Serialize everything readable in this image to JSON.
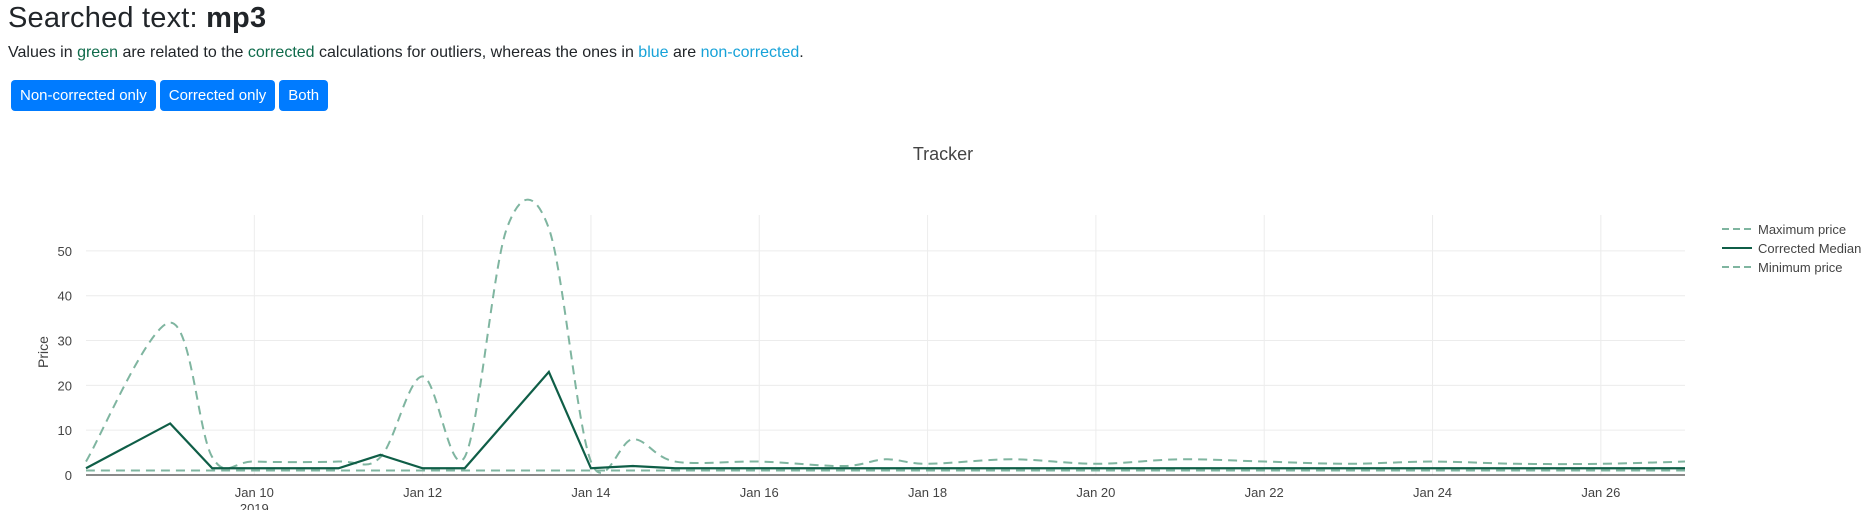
{
  "header": {
    "title_prefix": "Searched text: ",
    "title_term": "mp3"
  },
  "description": {
    "part1": "Values in ",
    "green_word": "green",
    "part2": " are related to the ",
    "corrected_word": "corrected",
    "part3": " calculations for outliers, whereas the ones in ",
    "blue_word": "blue",
    "part4": " are ",
    "noncorrected_word": "non-corrected",
    "part5": "."
  },
  "buttons": {
    "non_corrected": "Non-corrected only",
    "corrected": "Corrected only",
    "both": "Both"
  },
  "colors": {
    "button": "#007bff",
    "corrected": "#0f6b4b",
    "non_corrected": "#17a2d8",
    "series_dashed": "#7fb5a0",
    "series_solid": "#0f5e47"
  },
  "chart_data": {
    "type": "line",
    "title": "Tracker",
    "ylabel": "Price",
    "xlabel": "",
    "ylim": [
      0,
      58
    ],
    "y_ticks": [
      0,
      10,
      20,
      30,
      40,
      50
    ],
    "x_range": [
      "2019-01-08",
      "2019-01-27"
    ],
    "x_ticks": [
      {
        "date": "2019-01-10",
        "label": "Jan 10",
        "sublabel": "2019"
      },
      {
        "date": "2019-01-12",
        "label": "Jan 12",
        "sublabel": ""
      },
      {
        "date": "2019-01-14",
        "label": "Jan 14",
        "sublabel": ""
      },
      {
        "date": "2019-01-16",
        "label": "Jan 16",
        "sublabel": ""
      },
      {
        "date": "2019-01-18",
        "label": "Jan 18",
        "sublabel": ""
      },
      {
        "date": "2019-01-20",
        "label": "Jan 20",
        "sublabel": ""
      },
      {
        "date": "2019-01-22",
        "label": "Jan 22",
        "sublabel": ""
      },
      {
        "date": "2019-01-24",
        "label": "Jan 24",
        "sublabel": ""
      },
      {
        "date": "2019-01-26",
        "label": "Jan 26",
        "sublabel": ""
      }
    ],
    "grid": true,
    "legend_position": "top-right",
    "series": [
      {
        "name": "Maximum price",
        "dash": "dashed",
        "x": [
          "2019-01-08",
          "2019-01-09",
          "2019-01-09 12:00",
          "2019-01-10",
          "2019-01-11",
          "2019-01-11 12:00",
          "2019-01-12",
          "2019-01-12 12:00",
          "2019-01-13",
          "2019-01-13 12:00",
          "2019-01-14",
          "2019-01-14 12:00",
          "2019-01-15",
          "2019-01-16",
          "2019-01-17",
          "2019-01-17 12:00",
          "2019-01-18",
          "2019-01-19",
          "2019-01-20",
          "2019-01-21",
          "2019-01-22",
          "2019-01-23",
          "2019-01-24",
          "2019-01-25",
          "2019-01-26",
          "2019-01-27"
        ],
        "y": [
          3,
          34,
          4,
          3,
          3,
          4,
          22,
          4,
          55,
          55,
          3,
          8,
          3,
          3,
          2,
          3.5,
          2.5,
          3.5,
          2.5,
          3.5,
          3,
          2.5,
          3,
          2.5,
          2.5,
          3
        ]
      },
      {
        "name": "Corrected Median",
        "dash": "solid",
        "x": [
          "2019-01-08",
          "2019-01-09",
          "2019-01-09 12:00",
          "2019-01-10",
          "2019-01-11",
          "2019-01-11 12:00",
          "2019-01-12",
          "2019-01-12 12:00",
          "2019-01-13 12:00",
          "2019-01-14",
          "2019-01-14 12:00",
          "2019-01-15",
          "2019-01-16",
          "2019-01-17",
          "2019-01-18",
          "2019-01-20",
          "2019-01-22",
          "2019-01-24",
          "2019-01-26",
          "2019-01-27"
        ],
        "y": [
          1.5,
          11.5,
          1.5,
          1.5,
          1.5,
          4.5,
          1.5,
          1.5,
          23,
          1.5,
          2,
          1.5,
          1.5,
          1.5,
          1.5,
          1.5,
          1.5,
          1.5,
          1.5,
          1.5
        ]
      },
      {
        "name": "Minimum price",
        "dash": "dashed",
        "x": [
          "2019-01-08",
          "2019-01-10",
          "2019-01-12",
          "2019-01-14",
          "2019-01-16",
          "2019-01-18",
          "2019-01-20",
          "2019-01-22",
          "2019-01-24",
          "2019-01-26",
          "2019-01-27"
        ],
        "y": [
          1,
          1,
          1,
          1,
          1,
          1,
          1,
          1,
          1,
          1,
          1
        ]
      }
    ]
  }
}
